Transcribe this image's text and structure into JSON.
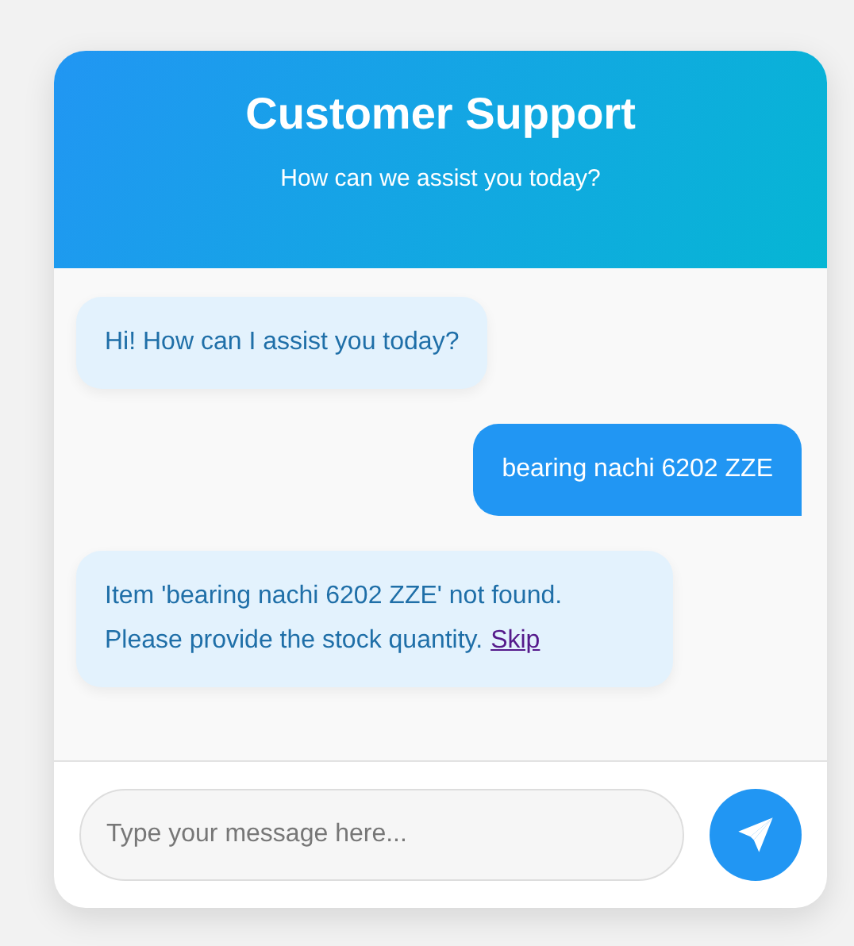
{
  "header": {
    "title": "Customer Support",
    "subtitle": "How can we assist you today?"
  },
  "messages": [
    {
      "kind": "bot",
      "text": "Hi! How can I assist you today?"
    },
    {
      "kind": "user",
      "text": "bearing nachi 6202 ZZE"
    },
    {
      "kind": "bot",
      "text": "Item 'bearing nachi 6202 ZZE' not found. Please provide the stock quantity.",
      "link": "Skip"
    }
  ],
  "input": {
    "placeholder": "Type your message here..."
  }
}
